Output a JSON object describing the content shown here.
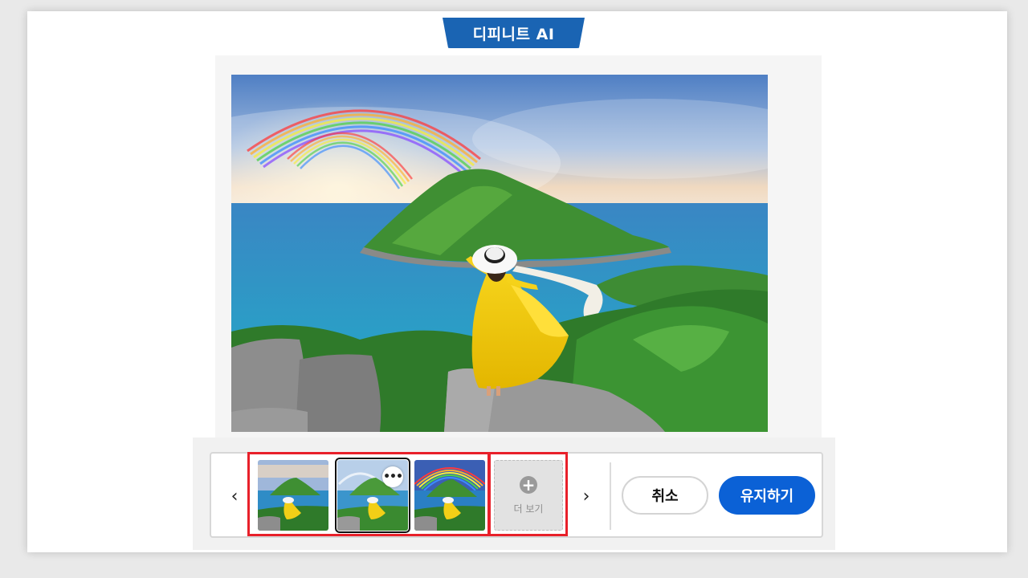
{
  "header": {
    "title": "디피니트 AI"
  },
  "variations": {
    "prev_arrow": "‹",
    "next_arrow": "›",
    "more_options": "•••",
    "see_more_icon": "+",
    "see_more_label": "더 보기",
    "thumbnails": [
      {
        "name": "variation-1",
        "selected": false
      },
      {
        "name": "variation-2",
        "selected": true
      },
      {
        "name": "variation-3",
        "selected": false
      }
    ]
  },
  "actions": {
    "cancel_label": "취소",
    "keep_label": "유지하기"
  },
  "colors": {
    "brand_blue": "#1a64b3",
    "primary_button": "#0b61d6",
    "highlight_red": "#e8202a"
  },
  "icons": [
    "chevron-left-icon",
    "chevron-right-icon",
    "more-options-icon",
    "plus-circle-icon"
  ]
}
